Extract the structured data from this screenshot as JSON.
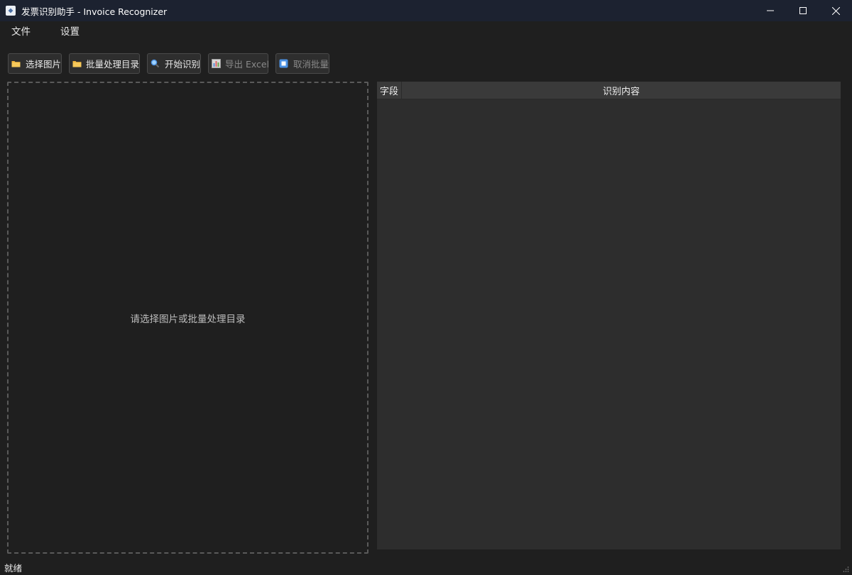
{
  "window": {
    "title": "发票识别助手 - Invoice Recognizer"
  },
  "menu": {
    "items": [
      {
        "label": "文件"
      },
      {
        "label": "设置"
      }
    ]
  },
  "toolbar": {
    "buttons": [
      {
        "label": "选择图片",
        "icon": "folder-icon",
        "enabled": true
      },
      {
        "label": "批量处理目录",
        "icon": "folder-icon",
        "enabled": true
      },
      {
        "label": "开始识别",
        "icon": "magnifier-icon",
        "enabled": true
      },
      {
        "label": "导出 Excel",
        "icon": "chart-icon",
        "enabled": false
      },
      {
        "label": "取消批量",
        "icon": "stop-icon",
        "enabled": false
      }
    ]
  },
  "preview": {
    "placeholder": "请选择图片或批量处理目录"
  },
  "table": {
    "columns": [
      "字段",
      "识别内容"
    ],
    "rows": []
  },
  "status": {
    "text": "就绪"
  },
  "colors": {
    "titlebar": "#1c2230",
    "background": "#1f1f1f",
    "table_bg": "#2d2d2d",
    "table_header": "#3a3a3a",
    "folder": "#f0b43c",
    "accent_blue": "#4a90e2"
  }
}
